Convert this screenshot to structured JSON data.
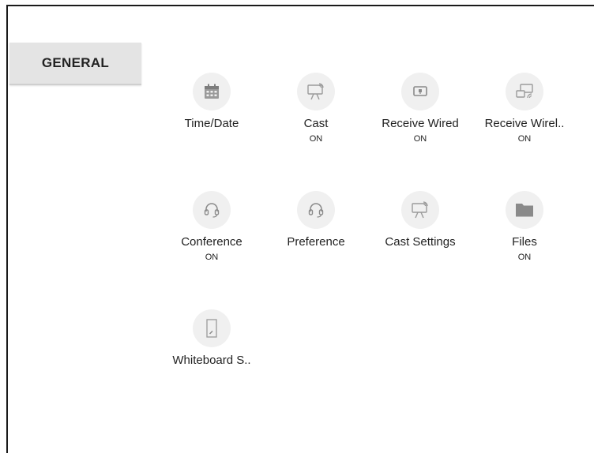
{
  "tabs": [
    {
      "label": "GENERAL"
    }
  ],
  "tiles": [
    {
      "label": "Time/Date",
      "status": "",
      "icon": "calendar-icon"
    },
    {
      "label": "Cast",
      "status": "ON",
      "icon": "cast-icon"
    },
    {
      "label": "Receive Wired",
      "status": "ON",
      "icon": "wired-display-icon"
    },
    {
      "label": "Receive Wirel..",
      "status": "ON",
      "icon": "wireless-screen-icon"
    },
    {
      "label": "Conference",
      "status": "ON",
      "icon": "headset-icon"
    },
    {
      "label": "Preference",
      "status": "",
      "icon": "headset-icon"
    },
    {
      "label": "Cast Settings",
      "status": "",
      "icon": "cast-icon"
    },
    {
      "label": "Files",
      "status": "ON",
      "icon": "folder-icon"
    },
    {
      "label": "Whiteboard S..",
      "status": "",
      "icon": "whiteboard-icon"
    }
  ]
}
